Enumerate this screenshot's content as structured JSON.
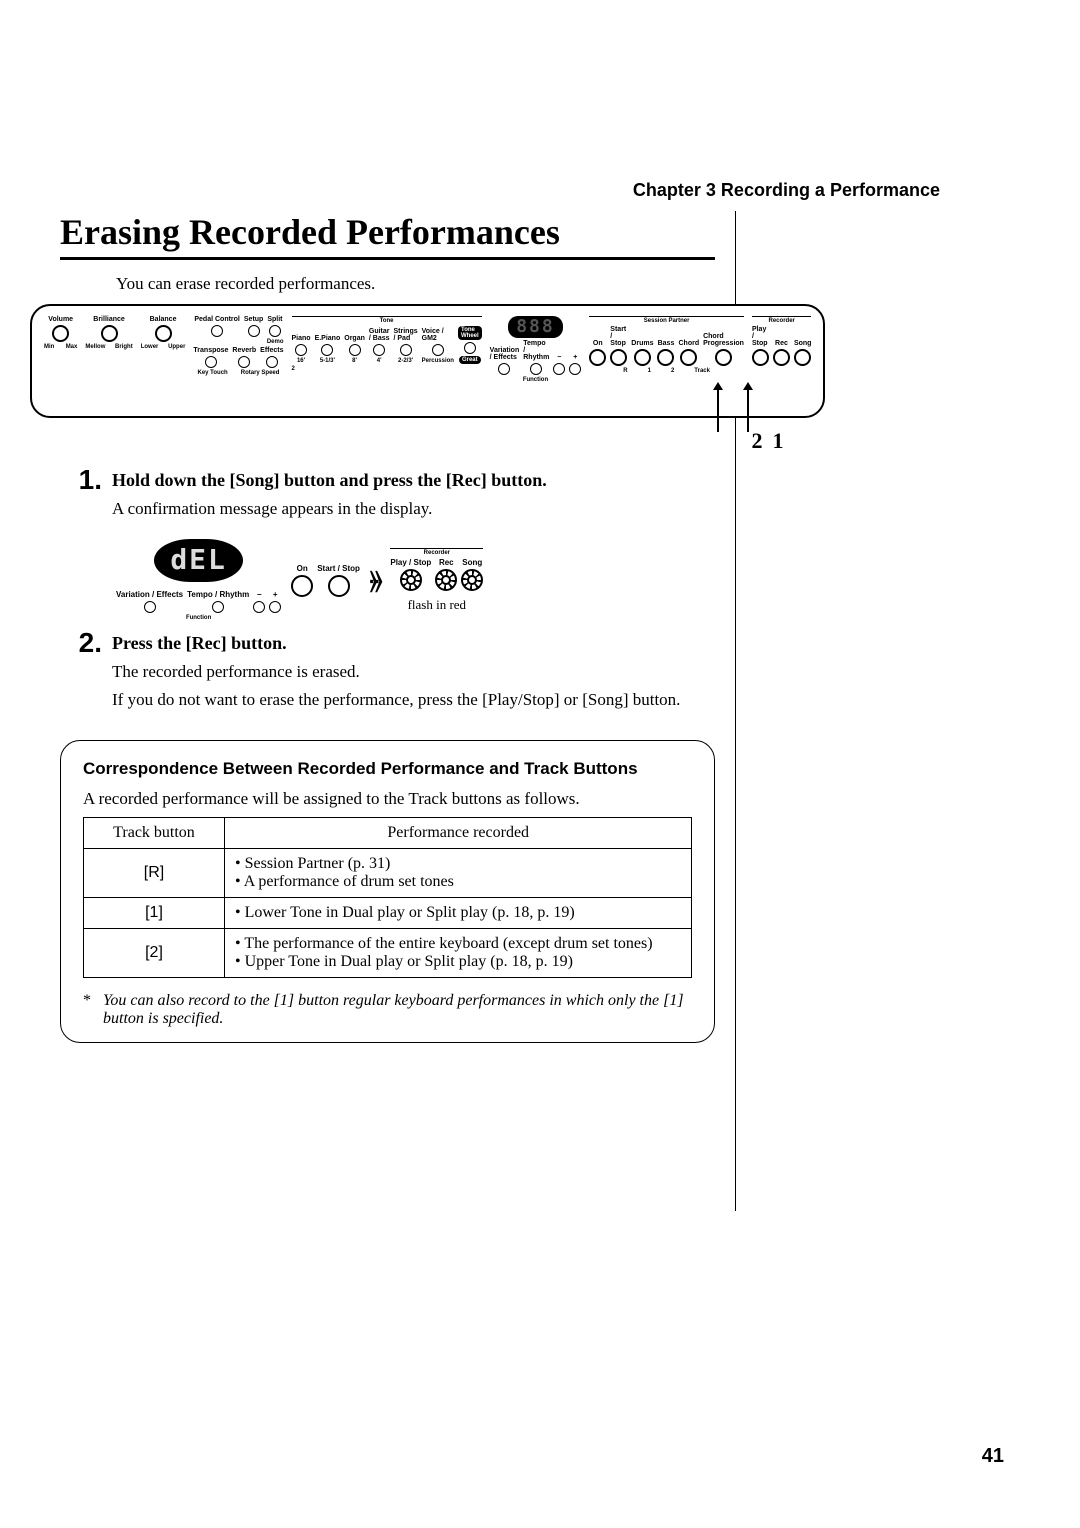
{
  "header": {
    "chapter_line": "Chapter 3 Recording a Performance"
  },
  "title": "Erasing Recorded Performances",
  "intro": "You can erase recorded performances.",
  "panel": {
    "volume": "Volume",
    "brilliance": "Brilliance",
    "balance": "Balance",
    "min": "Min",
    "max": "Max",
    "mellow": "Mellow",
    "bright": "Bright",
    "lower": "Lower",
    "upper": "Upper",
    "pedal_control": "Pedal Control",
    "setup": "Setup",
    "split": "Split",
    "demo": "Demo",
    "transpose": "Transpose",
    "reverb": "Reverb",
    "effects": "Effects",
    "key_touch": "Key Touch",
    "rotary_speed": "Rotary Speed",
    "tone_group": "Tone",
    "piano": "Piano",
    "epiano": "E.Piano",
    "organ": "Organ",
    "guitar_bass": "Guitar / Bass",
    "strings_pad": "Strings / Pad",
    "voice_gm2": "Voice / GM2",
    "tone_wheel": "Tone Wheel",
    "p16": "16'",
    "p5_13": "5-1/3'",
    "p8": "8'",
    "p4": "4'",
    "p2_23": "2-2/3'",
    "percussion": "Percussion",
    "great": "Great",
    "variation_effects": "Variation / Effects",
    "tempo_rhythm": "Tempo / Rhythm",
    "minus": "−",
    "plus": "+",
    "function_label": "Function",
    "session_partner": "Session Partner",
    "on": "On",
    "start_stop": "Start / Stop",
    "drums": "Drums",
    "bass": "Bass",
    "chord": "Chord",
    "progression": "Chord Progression",
    "recorder_group": "Recorder",
    "play_stop": "Play / Stop",
    "rec": "Rec",
    "song": "Song",
    "r_track": "R",
    "t1": "1",
    "t2": "2",
    "track_label": "Track",
    "seg_placeholder": "888",
    "callout_2": "2",
    "callout_1": "1"
  },
  "steps": [
    {
      "num": "1.",
      "head": "Hold down the [Song] button and press the [Rec] button.",
      "body": [
        "A confirmation message appears in the display."
      ]
    },
    {
      "num": "2.",
      "head": "Press the [Rec] button.",
      "body": [
        "The recorded performance is erased.",
        "If you do not want to erase the performance, press the [Play/Stop] or [Song] button."
      ]
    }
  ],
  "figure": {
    "display_text": "dEL",
    "variation_effects": "Variation / Effects",
    "tempo_rhythm": "Tempo / Rhythm",
    "minus": "−",
    "plus": "+",
    "function_label": "Function",
    "on": "On",
    "start_stop": "Start / Stop",
    "recorder": "Recorder",
    "play_stop": "Play / Stop",
    "rec": "Rec",
    "song": "Song",
    "flash_note": "flash in red"
  },
  "info": {
    "title": "Correspondence Between Recorded Performance and Track Buttons",
    "lead": "A recorded performance will be assigned to the Track buttons as follows.",
    "headers": [
      "Track button",
      "Performance recorded"
    ],
    "rows": [
      {
        "track": "[R]",
        "perf": "• Session Partner (p. 31)\n• A performance of drum set tones"
      },
      {
        "track": "[1]",
        "perf": "• Lower Tone in Dual play or Split play (p. 18, p. 19)"
      },
      {
        "track": "[2]",
        "perf": "• The performance of the entire keyboard (except drum set tones)\n• Upper Tone in Dual play or Split play (p. 18, p. 19)"
      }
    ],
    "footnote_mark": "*",
    "footnote": "You can also record to the [1] button regular keyboard performances in which only the [1] button is specified."
  },
  "page_number": "41"
}
